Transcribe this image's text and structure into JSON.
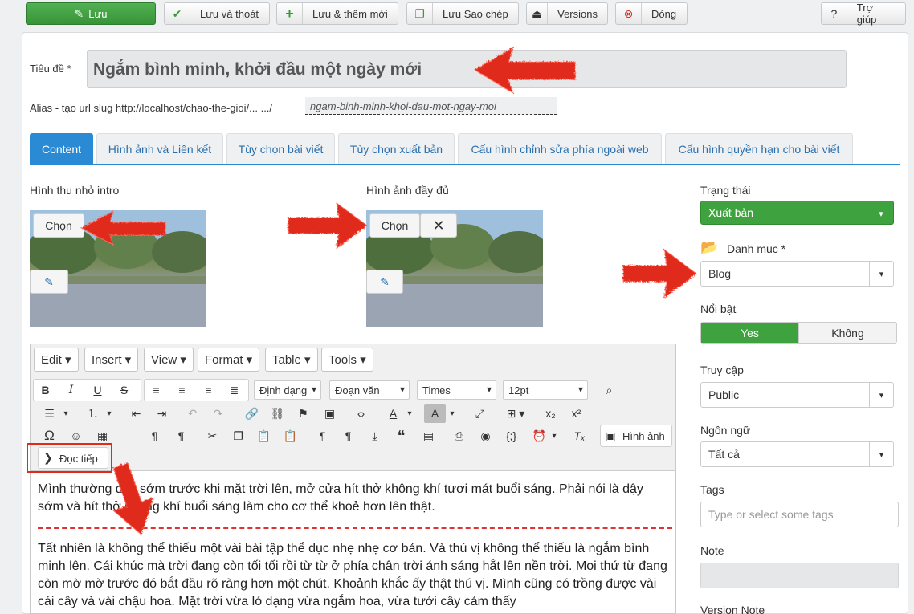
{
  "toolbar": {
    "save": "Lưu",
    "save_close": "Lưu và thoát",
    "save_new": "Lưu & thêm mới",
    "save_copy": "Lưu Sao chép",
    "versions": "Versions",
    "close": "Đóng",
    "help": "Trợ giúp"
  },
  "form": {
    "title_label": "Tiêu đề *",
    "title_value": "Ngắm bình minh, khởi đầu một ngày mới",
    "alias_label": "Alias - tạo url slug http://localhost/chao-the-gioi/... .../",
    "alias_value": "ngam-binh-minh-khoi-dau-mot-ngay-moi"
  },
  "tabs": [
    "Content",
    "Hình ảnh và Liên kết",
    "Tùy chọn bài viết",
    "Tùy chọn xuất bản",
    "Cấu hình chỉnh sửa phía ngoài web",
    "Cấu hình quyền hạn cho bài viết"
  ],
  "images": {
    "intro_label": "Hình thu nhỏ intro",
    "full_label": "Hình ảnh đầy đủ",
    "choose": "Chọn",
    "remove": "✕"
  },
  "editor": {
    "menus": [
      "Edit",
      "Insert",
      "View",
      "Format",
      "Table",
      "Tools"
    ],
    "format_select": "Định dạng",
    "block_select": "Đoạn văn",
    "font_select": "Times",
    "size_select": "12pt",
    "image_btn": "Hình ảnh",
    "readmore_btn": "Đọc tiếp",
    "para1": "Mình thường dậy sớm trước khi mặt trời lên, mở cửa hít thở không khí tươi mát buổi sáng. Phải nói là dậy sớm và hít thở không khí buổi sáng làm cho cơ thể khoẻ hơn lên thật.",
    "para2": "Tất nhiên là không thể thiếu một vài bài tập thể dục nhẹ nhẹ cơ bản. Và thú vị không thể thiếu là ngắm bình minh lên. Cái khúc mà trời đang còn tối tối rồi từ từ ở phía chân trời ánh sáng hắt lên nền trời. Mọi thứ từ đang còn mờ mờ trước đó bắt đầu rõ ràng hơn một chút. Khoảnh khắc ấy thật thú vị. Mình cũng có trồng được vài cái cây và vài chậu hoa. Mặt trời vừa ló dạng vừa ngắm hoa, vừa tưới cây cảm thấy"
  },
  "sidebar": {
    "status_label": "Trạng thái",
    "status_value": "Xuất bản",
    "category_label": "Danh mục *",
    "category_value": "Blog",
    "featured_label": "Nổi bật",
    "featured_yes": "Yes",
    "featured_no": "Không",
    "access_label": "Truy cập",
    "access_value": "Public",
    "language_label": "Ngôn ngữ",
    "language_value": "Tất cả",
    "tags_label": "Tags",
    "tags_placeholder": "Type or select some tags",
    "note_label": "Note",
    "version_note_label": "Version Note"
  },
  "colors": {
    "save_green": "#3ea33e",
    "tab_blue": "#2a8bd4",
    "arrow_red": "#e02a1a"
  }
}
